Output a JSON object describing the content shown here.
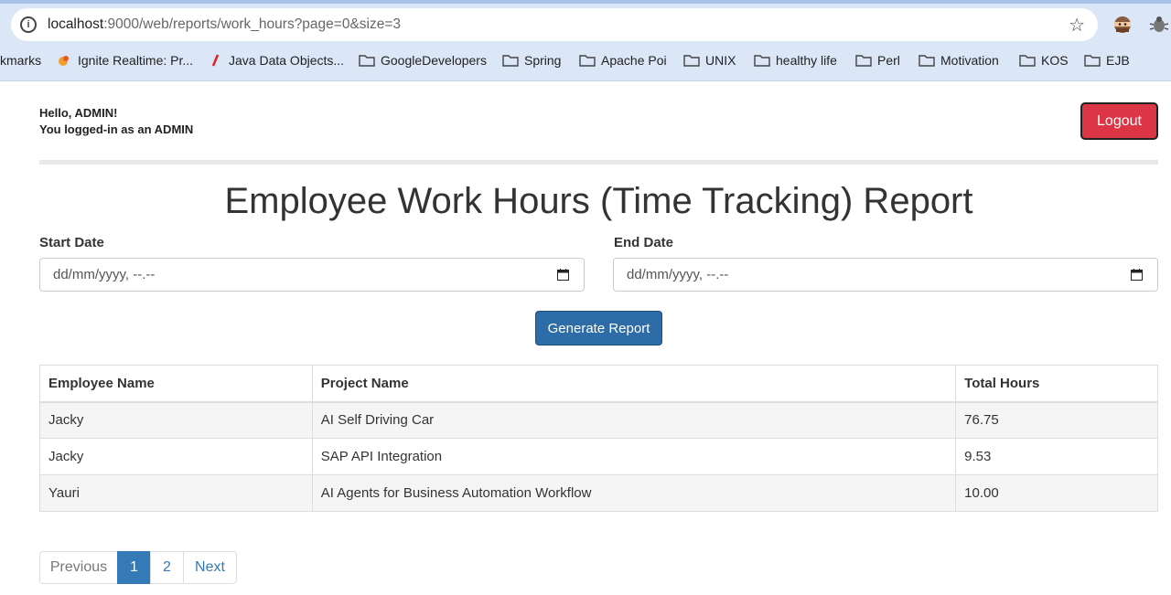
{
  "browser": {
    "url_host": "localhost",
    "url_rest": ":9000/web/reports/work_hours?page=0&size=3",
    "bookmarks": [
      {
        "label": "kmarks",
        "icon": "none"
      },
      {
        "label": "Ignite Realtime: Pr...",
        "icon": "ignite-icon"
      },
      {
        "label": "Java Data Objects...",
        "icon": "feather-icon"
      },
      {
        "label": "GoogleDevelopers",
        "icon": "folder-icon"
      },
      {
        "label": "Spring",
        "icon": "folder-icon"
      },
      {
        "label": "Apache Poi",
        "icon": "folder-icon"
      },
      {
        "label": "UNIX",
        "icon": "folder-icon"
      },
      {
        "label": "healthy life",
        "icon": "folder-icon"
      },
      {
        "label": "Perl",
        "icon": "folder-icon"
      },
      {
        "label": "Motivation",
        "icon": "folder-icon"
      },
      {
        "label": "KOS",
        "icon": "folder-icon"
      },
      {
        "label": "EJB",
        "icon": "folder-icon"
      }
    ]
  },
  "header": {
    "greeting_line1": "Hello, ADMIN!",
    "greeting_line2": "You logged-in as an ADMIN",
    "logout_label": "Logout"
  },
  "main": {
    "title": "Employee Work Hours (Time Tracking) Report",
    "start_date_label": "Start Date",
    "start_date_value": "dd/mm/yyyy, --.--",
    "end_date_label": "End Date",
    "end_date_value": "dd/mm/yyyy, --.--",
    "generate_label": "Generate Report"
  },
  "table": {
    "headers": [
      "Employee Name",
      "Project Name",
      "Total Hours"
    ],
    "rows": [
      [
        "Jacky",
        "AI Self Driving Car",
        "76.75"
      ],
      [
        "Jacky",
        "SAP API Integration",
        "9.53"
      ],
      [
        "Yauri",
        "AI Agents for Business Automation Workflow",
        "10.00"
      ]
    ]
  },
  "pagination": {
    "previous": "Previous",
    "pages": [
      "1",
      "2"
    ],
    "active_page": "1",
    "next": "Next"
  },
  "colors": {
    "logout_bg": "#dc3545",
    "primary": "#2d6ca6",
    "link": "#337ab7"
  }
}
